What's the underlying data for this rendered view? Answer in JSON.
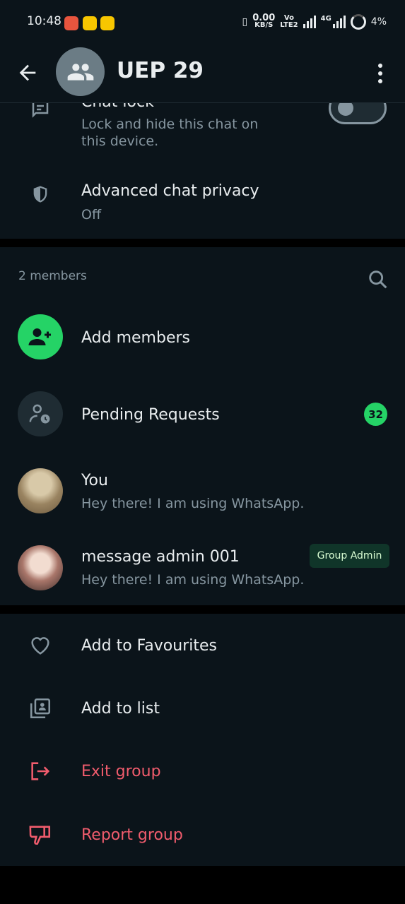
{
  "status_bar": {
    "time": "10:48",
    "net_speed_value": "0.00",
    "net_speed_unit": "KB/S",
    "volte_top": "Vo",
    "volte_bottom": "LTE2",
    "network": "4G",
    "battery": "4%"
  },
  "header": {
    "title": "UEP 29"
  },
  "settings": {
    "chat_lock": {
      "title": "Chat lock",
      "subtitle": "Lock and hide this chat on this device.",
      "enabled": false
    },
    "advanced_privacy": {
      "title": "Advanced chat privacy",
      "value": "Off"
    }
  },
  "members": {
    "count_label": "2 members",
    "add_label": "Add members",
    "pending_label": "Pending Requests",
    "pending_count": "32",
    "list": [
      {
        "name": "You",
        "status": "Hey there! I am using WhatsApp.",
        "tag": ""
      },
      {
        "name": "message admin 001",
        "status": "Hey there! I am using WhatsApp.",
        "tag": "Group Admin"
      }
    ]
  },
  "actions": {
    "favourites": "Add to Favourites",
    "add_list": "Add to list",
    "exit": "Exit group",
    "report": "Report group"
  },
  "colors": {
    "background": "#0b141a",
    "accent_green": "#25d366",
    "danger_red": "#f15c6d",
    "secondary_text": "#8696a0"
  }
}
